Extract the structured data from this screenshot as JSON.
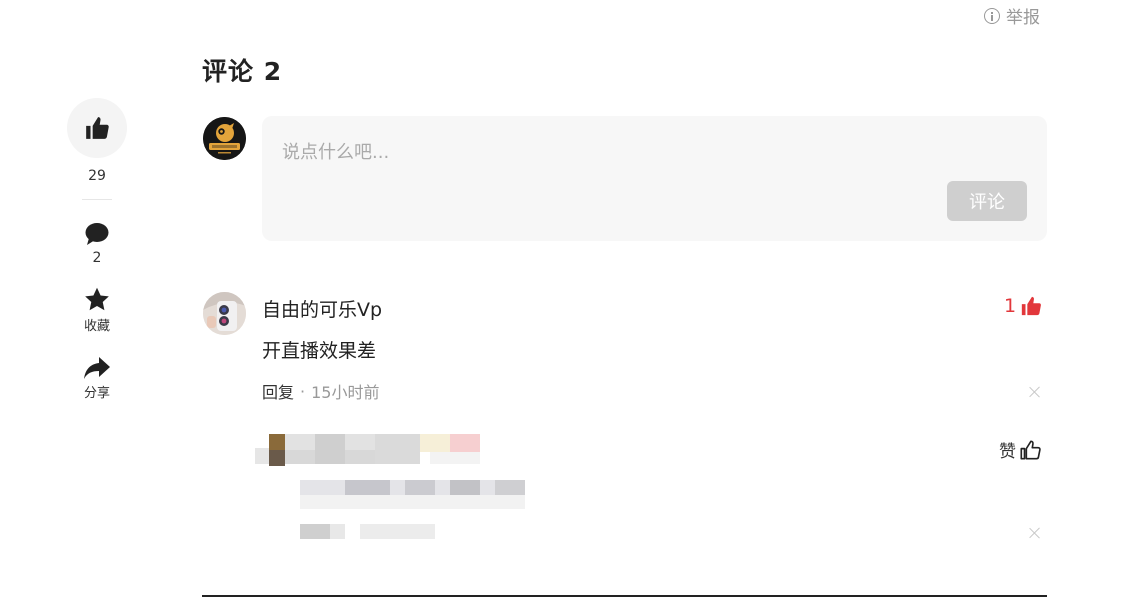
{
  "report": {
    "label": "举报",
    "icon": "info-circle-icon"
  },
  "rail": {
    "like": {
      "icon": "thumbs-up-icon",
      "count": "29"
    },
    "comment": {
      "icon": "comment-bubble-icon",
      "count": "2"
    },
    "favorite": {
      "icon": "star-icon",
      "label": "收藏"
    },
    "share": {
      "icon": "share-arrow-icon",
      "label": "分享"
    }
  },
  "comments": {
    "title": "评论 2",
    "composer": {
      "placeholder": "说点什么吧...",
      "value": "",
      "submit_label": "评论"
    },
    "items": [
      {
        "username": "自由的可乐Vp",
        "text": "开直播效果差",
        "reply_label": "回复",
        "separator": "·",
        "time": "15小时前",
        "likes": "1"
      }
    ],
    "reply_like_label": "赞"
  },
  "colors": {
    "accent_red": "#e2373b",
    "muted": "#999999",
    "composer_bg": "#f7f7f7",
    "button_disabled": "#cfcfcf"
  }
}
